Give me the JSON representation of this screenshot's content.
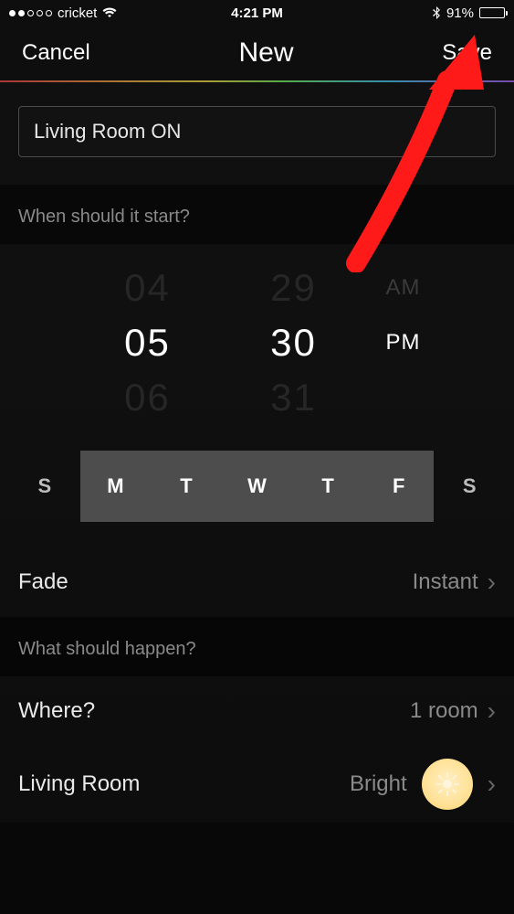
{
  "statusbar": {
    "carrier": "cricket",
    "time": "4:21 PM",
    "battery_pct": "91%"
  },
  "navbar": {
    "cancel": "Cancel",
    "title": "New",
    "save": "Save"
  },
  "name_input": {
    "value": "Living Room ON"
  },
  "sections": {
    "when_header": "When should it start?",
    "what_header": "What should happen?"
  },
  "picker": {
    "hour_prev": "04",
    "hour": "05",
    "hour_next": "06",
    "min_prev": "29",
    "min": "30",
    "min_next": "31",
    "ampm_prev": "AM",
    "ampm": "PM"
  },
  "days": [
    {
      "label": "S",
      "selected": false
    },
    {
      "label": "M",
      "selected": true
    },
    {
      "label": "T",
      "selected": true
    },
    {
      "label": "W",
      "selected": true
    },
    {
      "label": "T",
      "selected": true
    },
    {
      "label": "F",
      "selected": true
    },
    {
      "label": "S",
      "selected": false
    }
  ],
  "fade": {
    "label": "Fade",
    "value": "Instant"
  },
  "where": {
    "label": "Where?",
    "value": "1 room"
  },
  "room": {
    "name": "Living Room",
    "scene": "Bright",
    "icon": "sun-icon"
  }
}
